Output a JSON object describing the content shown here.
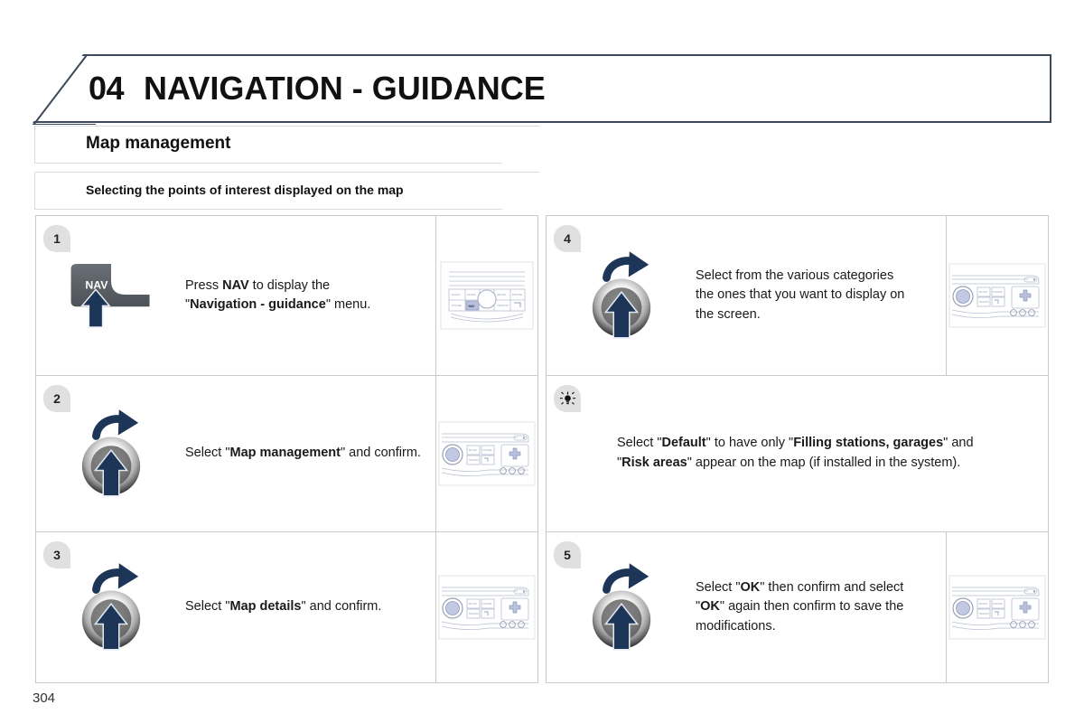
{
  "document": {
    "page_number": "304",
    "chapter_number": "04",
    "chapter_title": "NAVIGATION - GUIDANCE",
    "section_title": "Map management",
    "subsection_title": "Selecting the points of interest displayed on the map"
  },
  "colors": {
    "header_border": "#3c4a5a",
    "badge_bg": "#e0e0e0",
    "arrow_blue": "#1d3557",
    "nav_button_gray": "#5a5f66",
    "cell_border": "#c9c9c9",
    "panel_highlight": "#b9c0dd"
  },
  "steps": [
    {
      "id": "step-1",
      "badge": "1",
      "icon": "nav-button-icon",
      "text_parts": [
        {
          "t": "Press ",
          "b": false
        },
        {
          "t": "NAV",
          "b": true
        },
        {
          "t": " to display the\n\"",
          "b": false
        },
        {
          "t": "Navigation - guidance",
          "b": true
        },
        {
          "t": "\" menu.",
          "b": false
        }
      ],
      "media": "radio-panel-nav-highlight"
    },
    {
      "id": "step-2",
      "badge": "2",
      "icon": "rotary-knob-icon",
      "text_parts": [
        {
          "t": "Select \"",
          "b": false
        },
        {
          "t": "Map management",
          "b": true
        },
        {
          "t": "\" and confirm.",
          "b": false
        }
      ],
      "media": "radio-panel-wide"
    },
    {
      "id": "step-3",
      "badge": "3",
      "icon": "rotary-knob-icon",
      "text_parts": [
        {
          "t": "Select \"",
          "b": false
        },
        {
          "t": "Map details",
          "b": true
        },
        {
          "t": "\" and confirm.",
          "b": false
        }
      ],
      "media": "radio-panel-wide"
    },
    {
      "id": "step-4",
      "badge": "4",
      "icon": "rotary-knob-icon",
      "text_parts": [
        {
          "t": "Select from the various categories\nthe ones that you want to display on\nthe screen.",
          "b": false
        }
      ],
      "media": "radio-panel-wide"
    },
    {
      "id": "tip-1",
      "badge": "lightbulb-tip-icon",
      "icon": "none",
      "text_parts": [
        {
          "t": "Select \"",
          "b": false
        },
        {
          "t": "Default",
          "b": true
        },
        {
          "t": "\" to have only \"",
          "b": false
        },
        {
          "t": "Filling stations, garages",
          "b": true
        },
        {
          "t": "\" and\n\"",
          "b": false
        },
        {
          "t": "Risk areas",
          "b": true
        },
        {
          "t": "\" appear on the map (if installed in the system).",
          "b": false
        }
      ],
      "media": "none"
    },
    {
      "id": "step-5",
      "badge": "5",
      "icon": "rotary-knob-icon",
      "text_parts": [
        {
          "t": "Select \"",
          "b": false
        },
        {
          "t": "OK",
          "b": true
        },
        {
          "t": "\" then confirm and select\n\"",
          "b": false
        },
        {
          "t": "OK",
          "b": true
        },
        {
          "t": "\" again then confirm to save the\nmodifications.",
          "b": false
        }
      ],
      "media": "radio-panel-wide"
    }
  ],
  "radio_panel": {
    "nav_label": "NAV",
    "buttons": [
      "RADIO",
      "MUSIC",
      "SETUP",
      "TRAFFIC",
      "PHONE",
      "NAV",
      "TRAFFIC"
    ]
  }
}
